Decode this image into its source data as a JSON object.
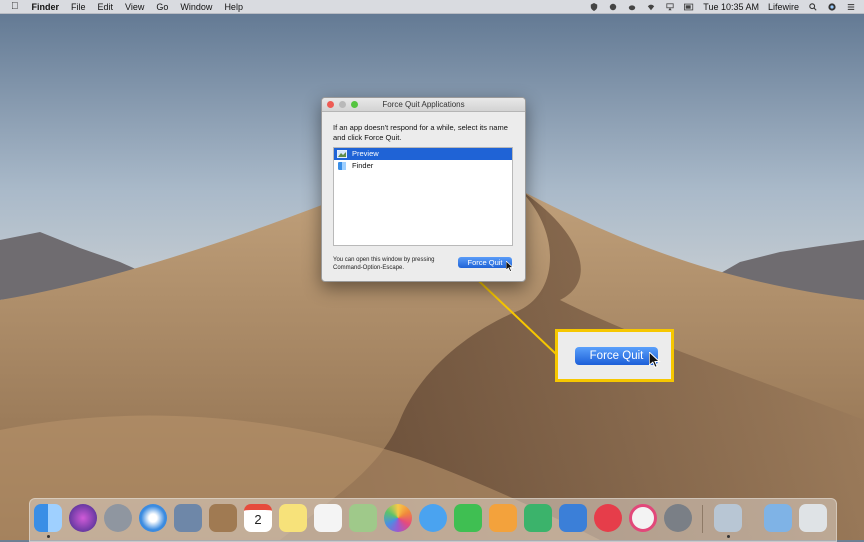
{
  "menubar": {
    "app_name": "Finder",
    "menus": [
      "File",
      "Edit",
      "View",
      "Go",
      "Window",
      "Help"
    ],
    "clock": "Tue 10:35 AM",
    "user": "Lifewire"
  },
  "force_quit": {
    "title": "Force Quit Applications",
    "message": "If an app doesn't respond for a while, select its name and click Force Quit.",
    "apps": [
      {
        "name": "Preview",
        "selected": true,
        "icon": "preview-icon"
      },
      {
        "name": "Finder",
        "selected": false,
        "icon": "finder-icon"
      }
    ],
    "hint": "You can open this window by pressing Command-Option-Escape.",
    "button_label": "Force Quit"
  },
  "callout": {
    "button_label": "Force Quit",
    "highlight_color": "#f6c700"
  },
  "dock": {
    "apps": [
      "finder-icon",
      "siri-icon",
      "launchpad-icon",
      "safari-icon",
      "mail-icon",
      "contacts-icon",
      "calendar-icon",
      "notes-icon",
      "reminders-icon",
      "maps-icon",
      "photos-icon",
      "messages-icon",
      "facetime-icon",
      "pages-icon",
      "numbers-icon",
      "keynote-icon",
      "news-icon",
      "itunes-icon",
      "system-preferences-icon",
      "preview-icon",
      "downloads-icon",
      "trash-icon"
    ],
    "calendar_date": "2"
  },
  "colors": {
    "selection": "#1f63d6",
    "highlight": "#f6c700"
  }
}
